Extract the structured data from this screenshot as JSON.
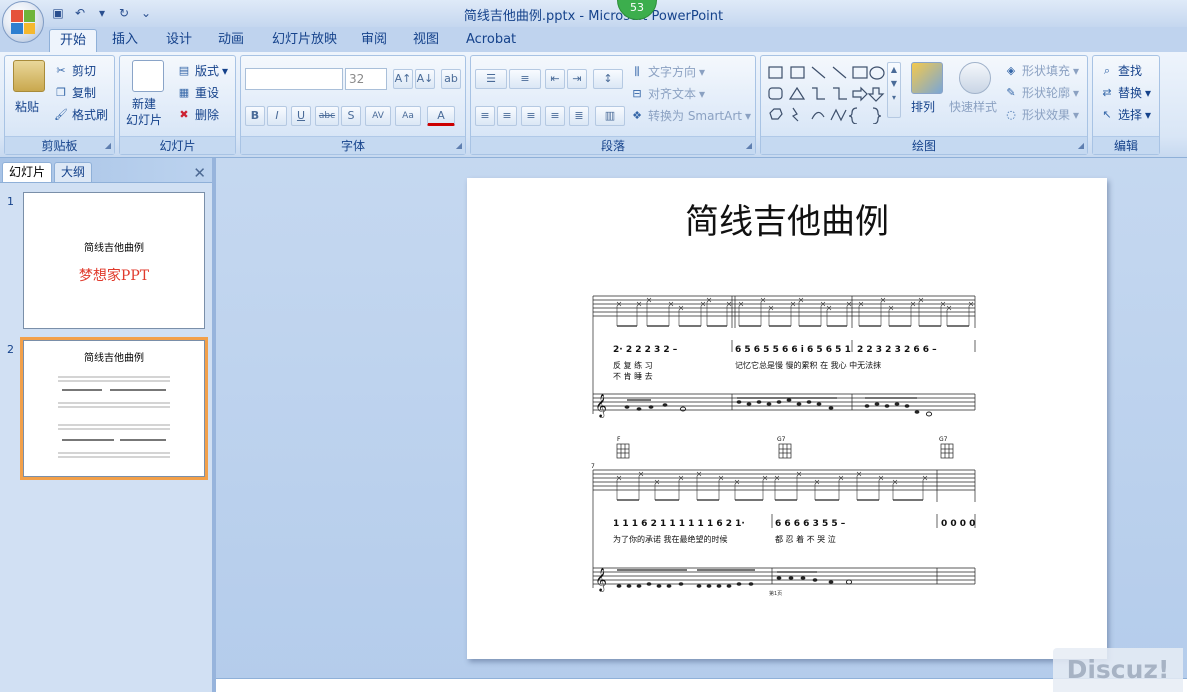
{
  "window": {
    "title": "简线吉他曲例.pptx - Microsoft PowerPoint",
    "badge": "53"
  },
  "tabs": [
    "开始",
    "插入",
    "设计",
    "动画",
    "幻灯片放映",
    "审阅",
    "视图",
    "Acrobat"
  ],
  "ribbon": {
    "clipboard": {
      "label": "剪贴板",
      "paste": "粘贴",
      "cut": "剪切",
      "copy": "复制",
      "format_painter": "格式刷"
    },
    "slides": {
      "label": "幻灯片",
      "new_slide": "新建\n幻灯片",
      "layout": "版式",
      "reset": "重设",
      "delete": "删除"
    },
    "font": {
      "label": "字体",
      "font_size": "32"
    },
    "paragraph": {
      "label": "段落",
      "text_direction": "文字方向",
      "align_text": "对齐文本",
      "smartart": "转换为 SmartArt"
    },
    "drawing": {
      "label": "绘图",
      "arrange": "排列",
      "quick_styles": "快速样式",
      "shape_fill": "形状填充",
      "shape_outline": "形状轮廓",
      "shape_effects": "形状效果"
    },
    "editing": {
      "label": "编辑",
      "find": "查找",
      "replace": "替换",
      "select": "选择"
    }
  },
  "panel": {
    "tabs": [
      "幻灯片",
      "大纲"
    ],
    "slides": [
      {
        "num": "1",
        "title": "简线吉他曲例",
        "subtitle": "梦想家PPT"
      },
      {
        "num": "2",
        "title": "简线吉他曲例"
      }
    ]
  },
  "slide": {
    "title": "简线吉他曲例",
    "score": {
      "row1_numbers_a": "2· 2 2 2 3 2   –",
      "row1_numbers_b": "6 5 6 5 5 6 6 i 6 5 6 5 1",
      "row1_numbers_c": "2 2 3 2 3 2 6 6   –",
      "row1_lyrics_a1": "反  复   练  习",
      "row1_lyrics_a2": "不  肯   睡  去",
      "row1_lyrics_b": "记忆它总是慢  慢的累积  在  我心  中无法抹",
      "chord_f": "F",
      "chord_g7a": "G7",
      "chord_g7b": "G7",
      "measure_7": "7",
      "row2_numbers_a": "1 1 1 6 2 1  1 1 1 1 1 6 2 1·",
      "row2_numbers_b": "6  6 6 6  3 5  5    –",
      "row2_numbers_c": "0 0 0 0",
      "row2_lyrics_a": "为了你的承诺 我在最绝望的时候",
      "row2_lyrics_b": "都  忍  着  不  哭 泣",
      "page_label": "第1页"
    }
  },
  "watermark": "Discuz!",
  "colors": {
    "accent": "#15428b",
    "selection": "#f2a04a",
    "thumb_subtitle": "#e03a2c"
  }
}
